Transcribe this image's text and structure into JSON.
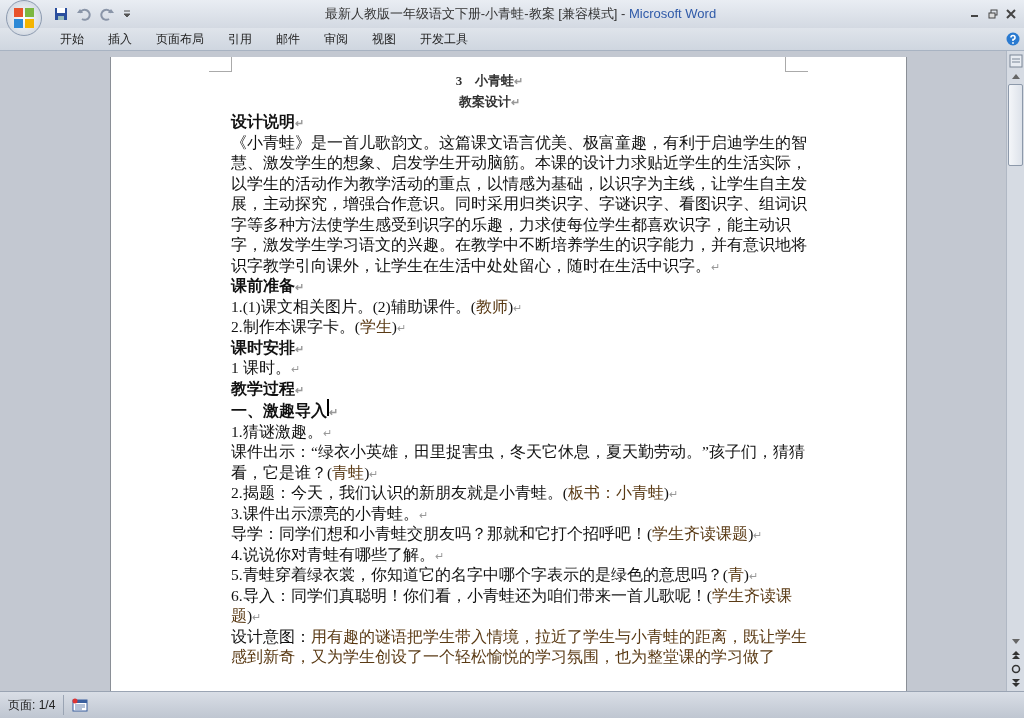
{
  "window": {
    "title": "最新人教版一年级语文下册-小青蛙-教案 [兼容模式]",
    "separator": "-",
    "app": "Microsoft Word"
  },
  "ribbon_tabs": [
    {
      "label": "开始"
    },
    {
      "label": "插入"
    },
    {
      "label": "页面布局"
    },
    {
      "label": "引用"
    },
    {
      "label": "邮件"
    },
    {
      "label": "审阅"
    },
    {
      "label": "视图"
    },
    {
      "label": "开发工具"
    }
  ],
  "document": {
    "paragraphs": [
      {
        "kind": "title",
        "parts": [
          {
            "text": "3　小青蛙"
          }
        ],
        "end_mark": "↵"
      },
      {
        "kind": "title",
        "parts": [
          {
            "text": "教案设计"
          }
        ],
        "end_mark": "↵"
      },
      {
        "kind": "heading",
        "parts": [
          {
            "text": "设计说明"
          }
        ],
        "end_mark": "↵"
      },
      {
        "kind": "body",
        "parts": [
          {
            "text": "《小青蛙》是一首儿歌韵文。这篇课文语言优美、极富童趣，有利于启迪学生的智慧、激发学生的想象、启发学生开动脑筋。本课的设计力求贴近学生的生活实际，以学生的活动作为教学活动的重点，以情感为基础，以识字为主线，让学生自主发展，主动探究，增强合作意识。同时采用归类识字、字谜识字、看图识字、组词识字等多种方法使学生感受到识字的乐趣，力求使每位学生都喜欢识字，能主动识字，激发学生学习语文的兴趣。在教学中不断培养学生的识字能力，并有意识地将识字教学引向课外，让学生在生活中处处留心，随时在生活中识字。"
          }
        ],
        "end_mark": "↵"
      },
      {
        "kind": "heading",
        "parts": [
          {
            "text": "课前准备"
          }
        ],
        "end_mark": "↵"
      },
      {
        "kind": "body",
        "parts": [
          {
            "text": "1.(1)课文相关图片。(2)辅助课件。("
          },
          {
            "text": "教师",
            "kind": "note"
          },
          {
            "text": ")"
          }
        ],
        "end_mark": "↵"
      },
      {
        "kind": "body",
        "parts": [
          {
            "text": "2.制作本课字卡。("
          },
          {
            "text": "学生",
            "kind": "note"
          },
          {
            "text": ")"
          }
        ],
        "end_mark": "↵"
      },
      {
        "kind": "heading",
        "parts": [
          {
            "text": "课时安排"
          }
        ],
        "end_mark": "↵"
      },
      {
        "kind": "body",
        "parts": [
          {
            "text": "1 课时。"
          }
        ],
        "end_mark": "↵"
      },
      {
        "kind": "heading",
        "parts": [
          {
            "text": "教学过程"
          }
        ],
        "end_mark": "↵"
      },
      {
        "kind": "heading",
        "parts": [
          {
            "text": "一、激趣导入"
          }
        ],
        "end_mark": "↵",
        "cursor": true
      },
      {
        "kind": "body",
        "parts": [
          {
            "text": "1.猜谜激趣。"
          }
        ],
        "end_mark": "↵"
      },
      {
        "kind": "body",
        "parts": [
          {
            "text": "课件出示：“绿衣小英雄，田里捉害虫，冬天它休息，夏天勤劳动。”孩子们，猜猜看，它是谁？("
          },
          {
            "text": "青蛙",
            "kind": "note"
          },
          {
            "text": ")"
          }
        ],
        "end_mark": "↵"
      },
      {
        "kind": "body",
        "parts": [
          {
            "text": "2.揭题：今天，我们认识的新朋友就是小青蛙。("
          },
          {
            "text": "板书：小青蛙",
            "kind": "note"
          },
          {
            "text": ")"
          }
        ],
        "end_mark": "↵"
      },
      {
        "kind": "body",
        "parts": [
          {
            "text": "3.课件出示漂亮的小青蛙。"
          }
        ],
        "end_mark": "↵"
      },
      {
        "kind": "body",
        "parts": [
          {
            "text": "导学：同学们想和小青蛙交朋友吗？那就和它打个招呼吧！("
          },
          {
            "text": "学生齐读课题",
            "kind": "note"
          },
          {
            "text": ")"
          }
        ],
        "end_mark": "↵"
      },
      {
        "kind": "body",
        "parts": [
          {
            "text": "4.说说你对青蛙有哪些了解。"
          }
        ],
        "end_mark": "↵"
      },
      {
        "kind": "body",
        "parts": [
          {
            "text": "5.青蛙穿着绿衣裳，你知道它的名字中哪个字表示的是绿色的意思吗？("
          },
          {
            "text": "青",
            "kind": "note"
          },
          {
            "text": ")"
          }
        ],
        "end_mark": "↵"
      },
      {
        "kind": "body",
        "parts": [
          {
            "text": "6.导入：同学们真聪明！你们看，小青蛙还为咱们带来一首儿歌呢！("
          },
          {
            "text": "学生齐读课题",
            "kind": "note"
          },
          {
            "text": ")"
          }
        ],
        "end_mark": "↵"
      },
      {
        "kind": "body",
        "parts": [
          {
            "text": "设计意图："
          },
          {
            "text": "用有趣的谜语把学生带入情境，拉近了学生与小青蛙的距离，既让学生感到新奇，又为学生创设了一个轻松愉悦的学习氛围，也为整堂课的学习做了",
            "kind": "note"
          }
        ]
      }
    ]
  },
  "status_bar": {
    "page": "页面: 1/4"
  }
}
